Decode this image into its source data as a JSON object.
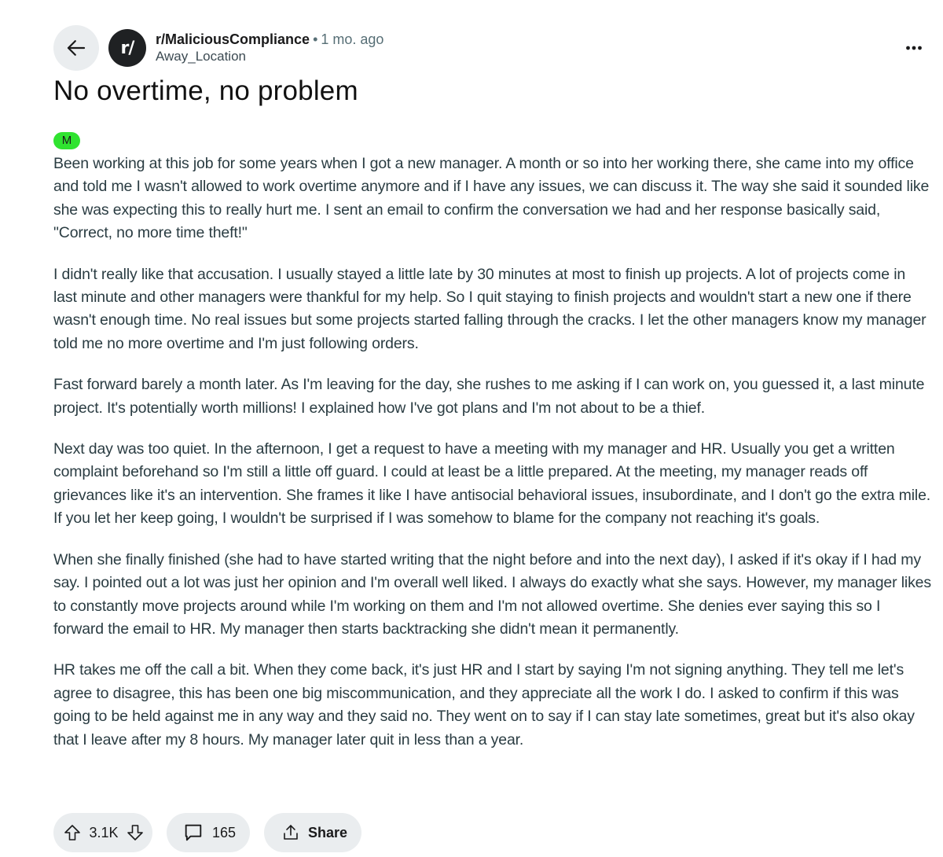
{
  "header": {
    "subreddit": "r/MaliciousCompliance",
    "separator": "•",
    "time_ago": "1 mo. ago",
    "author": "Away_Location",
    "avatar_text": "r/",
    "icons": {
      "back": "arrow-left-icon",
      "more": "more-horizontal-icon"
    }
  },
  "post": {
    "title": "No overtime, no problem",
    "flair": "M",
    "flair_color": "#30e330",
    "paragraphs": [
      "Been working at this job for some years when I got a new manager. A month or so into her working there, she came into my office and told me I wasn't allowed to work overtime anymore and if I have any issues, we can discuss it. The way she said it sounded like she was expecting this to really hurt me. I sent an email to confirm the conversation we had and her response basically said, \"Correct, no more time theft!\"",
      "I didn't really like that accusation. I usually stayed a little late by 30 minutes at most to finish up projects. A lot of projects come in last minute and other managers were thankful for my help. So I quit staying to finish projects and wouldn't start a new one if there wasn't enough time. No real issues but some projects started falling through the cracks. I let the other managers know my manager told me no more overtime and I'm just following orders.",
      "Fast forward barely a month later. As I'm leaving for the day, she rushes to me asking if I can work on, you guessed it, a last minute project. It's potentially worth millions! I explained how I've got plans and I'm not about to be a thief.",
      "Next day was too quiet. In the afternoon, I get a request to have a meeting with my manager and HR. Usually you get a written complaint beforehand so I'm still a little off guard. I could at least be a little prepared. At the meeting, my manager reads off grievances like it's an intervention. She frames it like I have antisocial behavioral issues, insubordinate, and I don't go the extra mile. If you let her keep going, I wouldn't be surprised if I was somehow to blame for the company not reaching it's goals.",
      "When she finally finished (she had to have started writing that the night before and into the next day), I asked if it's okay if I had my say. I pointed out a lot was just her opinion and I'm overall well liked. I always do exactly what she says. However, my manager likes to constantly move projects around while I'm working on them and I'm not allowed overtime. She denies ever saying this so I forward the email to HR. My manager then starts backtracking she didn't mean it permanently.",
      "HR takes me off the call a bit. When they come back, it's just HR and I start by saying I'm not signing anything. They tell me let's agree to disagree, this has been one big miscommunication, and they appreciate all the work I do. I asked to confirm if this was going to be held against me in any way and they said no. They went on to say if I can stay late sometimes, great but it's also okay that I leave after my 8 hours. My manager later quit in less than a year."
    ]
  },
  "actions": {
    "votes": "3.1K",
    "comments": "165",
    "share_label": "Share",
    "icons": {
      "upvote": "upvote-arrow-icon",
      "downvote": "downvote-arrow-icon",
      "comment": "comment-bubble-icon",
      "share": "share-upload-icon"
    }
  },
  "colors": {
    "pill_background": "#eaedef",
    "avatar_background": "#1f2123",
    "body_text": "#2a3c42",
    "meta_text": "#576f76"
  }
}
